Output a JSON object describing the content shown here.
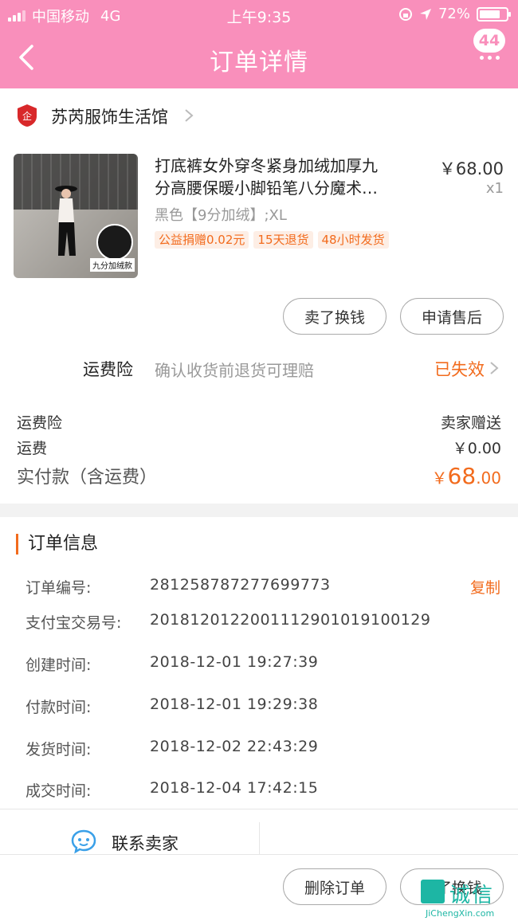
{
  "status_bar": {
    "carrier": "中国移动",
    "network": "4G",
    "time": "上午9:35",
    "battery": "72%"
  },
  "nav": {
    "title": "订单详情",
    "message_count": "44"
  },
  "shop": {
    "name": "苏芮服饰生活馆"
  },
  "product": {
    "title_line1": "打底裤女外穿冬紧身加绒加厚九",
    "title_line2": "分高腰保暖小脚铅笔八分魔术…",
    "price": "￥68.00",
    "quantity": "x1",
    "sku": "黑色【9分加绒】;XL",
    "tags": [
      "公益捐赠0.02元",
      "15天退货",
      "48小时发货"
    ],
    "image_tag": "九分加绒款"
  },
  "product_actions": {
    "sell_label": "卖了换钱",
    "after_sale_label": "申请售后"
  },
  "insurance": {
    "label": "运费险",
    "description": "确认收货前退货可理赔",
    "status": "已失效"
  },
  "costs": {
    "insurance_label": "运费险",
    "insurance_value": "卖家赠送",
    "shipping_label": "运费",
    "shipping_value": "￥0.00",
    "paid_label": "实付款（含运费）",
    "paid_currency": "￥",
    "paid_int": "68",
    "paid_dec": ".00"
  },
  "order_info": {
    "title": "订单信息",
    "copy_label": "复制",
    "rows": [
      {
        "key": "订单编号:",
        "value": "281258787277699773"
      },
      {
        "key": "支付宝交易号:",
        "value": "2018120122001129010191001​29"
      },
      {
        "key": "创建时间:",
        "value": "2018-12-01 19:27:39"
      },
      {
        "key": "付款时间:",
        "value": "2018-12-01 19:29:38"
      },
      {
        "key": "发货时间:",
        "value": "2018-12-02 22:43:29"
      },
      {
        "key": "成交时间:",
        "value": "2018-12-04 17:42:15"
      }
    ]
  },
  "contact": {
    "label": "联系卖家"
  },
  "bottom_actions": {
    "delete_label": "删除订单",
    "sell_label": "卖了换钱"
  },
  "watermark": {
    "text": "诚信",
    "url": "JiChengXin.com"
  },
  "colors": {
    "header": "#f98fbb",
    "accent": "#f26b1d"
  }
}
